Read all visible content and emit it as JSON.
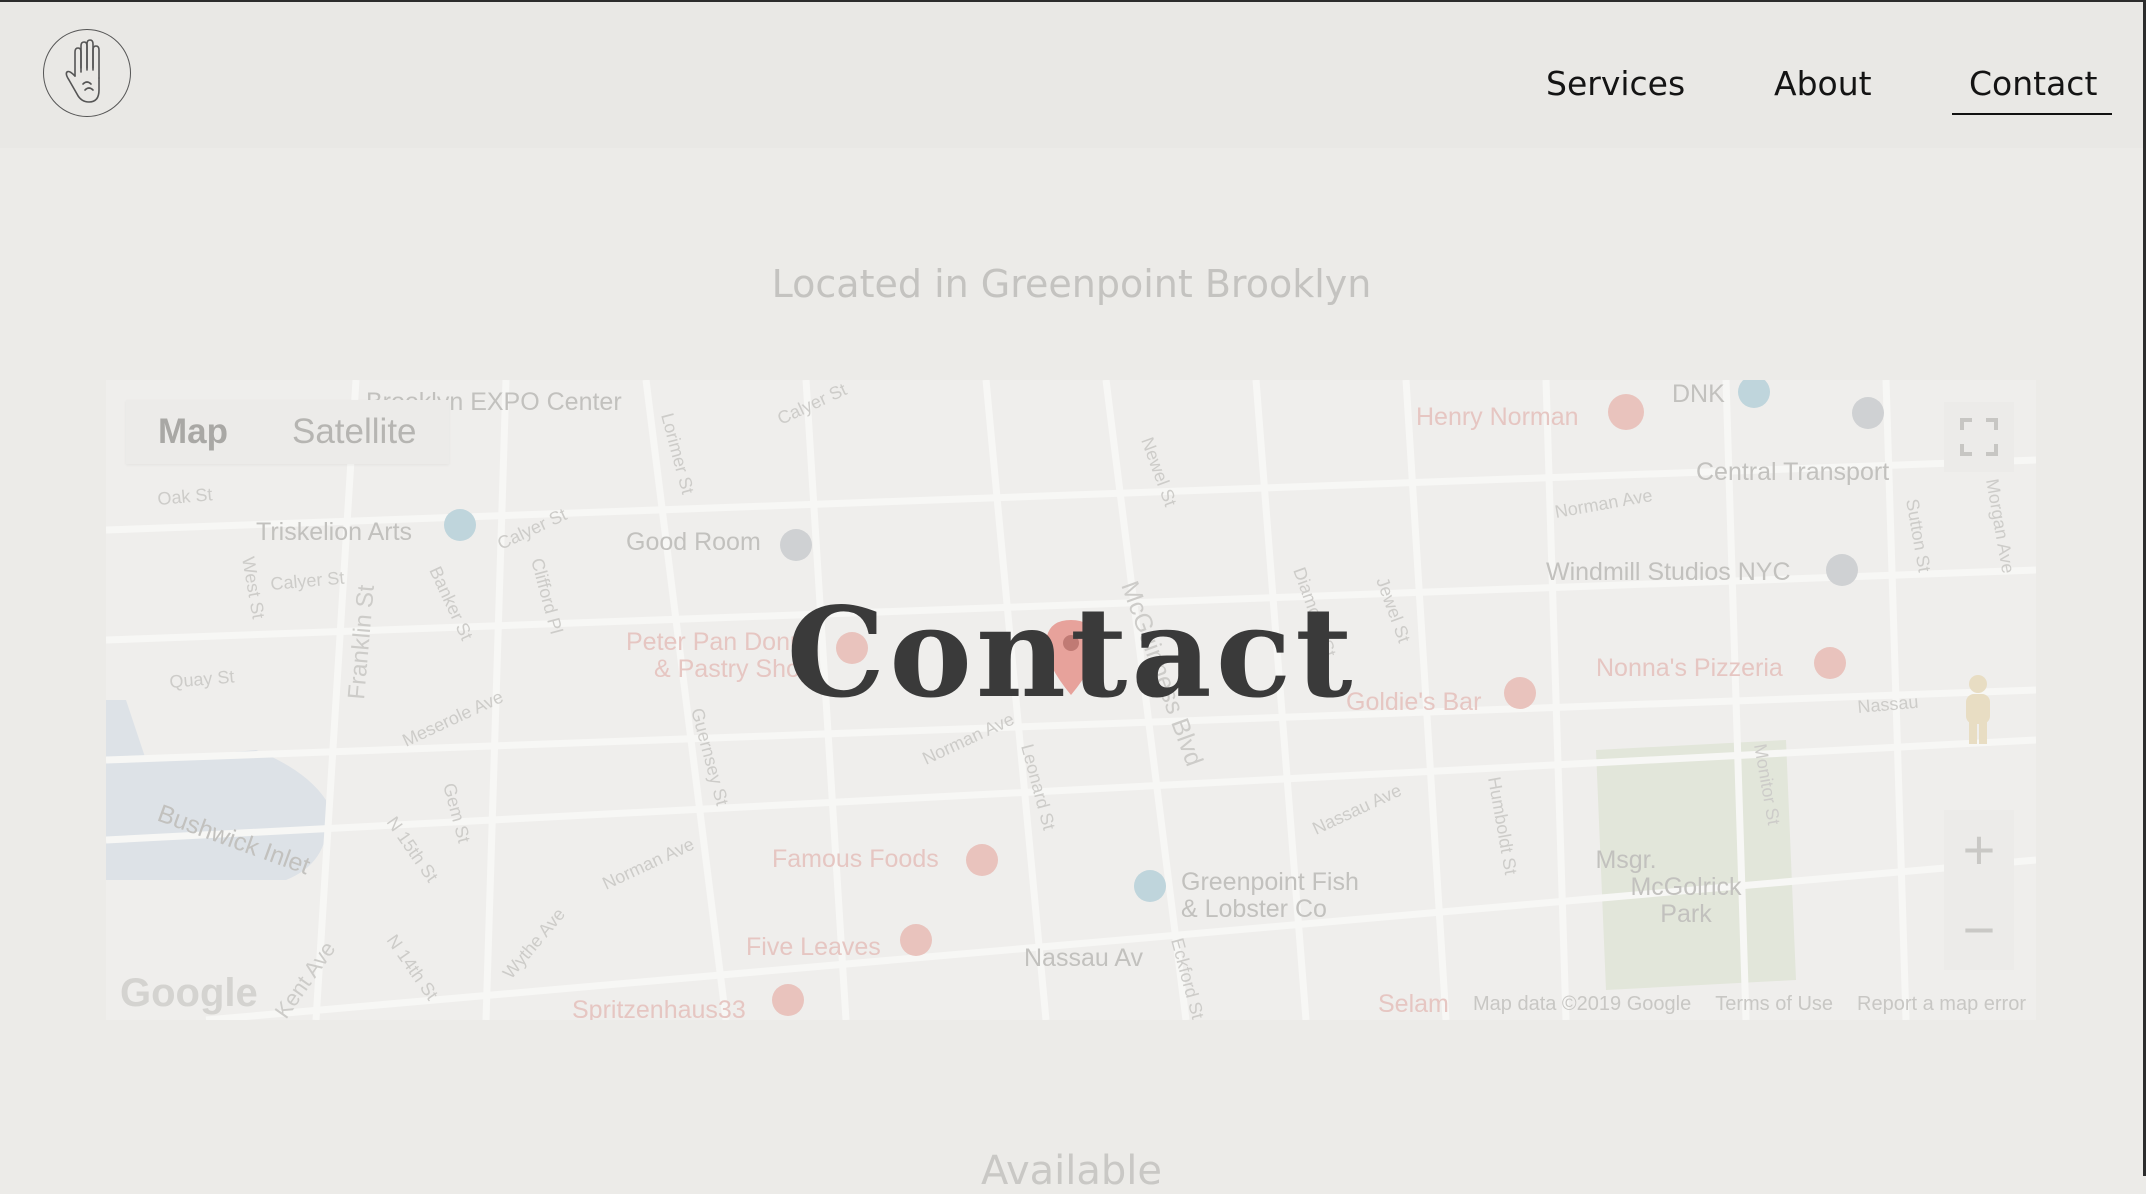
{
  "nav": {
    "services": "Services",
    "about": "About",
    "contact": "Contact"
  },
  "hero": {
    "subtitle": "Located in Greenpoint Brooklyn",
    "title": "Contact",
    "next_section": "Available"
  },
  "map": {
    "type_map": "Map",
    "type_satellite": "Satellite",
    "zoom_in": "+",
    "zoom_out": "−",
    "google_logo": "Google",
    "map_data": "Map data ©2019 Google",
    "terms": "Terms of Use",
    "report": "Report a map error",
    "poi_labels": {
      "expo": "Brooklyn EXPO Center",
      "triskelion": "Triskelion Arts",
      "good_room": "Good Room",
      "peter_pan_1": "Peter Pan Donut",
      "peter_pan_2": "& Pastry Shop",
      "famous_foods": "Famous Foods",
      "five_leaves": "Five Leaves",
      "spritzenhaus": "Spritzenhaus33",
      "henry_norman": "Henry Norman",
      "dnk": "DNK",
      "central_transport": "Central Transport",
      "windmill": "Windmill Studios NYC",
      "nonnas": "Nonna's Pizzeria",
      "goldies": "Goldie's Bar",
      "greenpoint_fish_1": "Greenpoint Fish",
      "greenpoint_fish_2": "& Lobster Co",
      "nassau_av": "Nassau Av",
      "park_1": "Msgr.",
      "park_2": "McGolrick",
      "park_3": "Park",
      "bushwick": "Bushwick Inlet",
      "selamat": "Selam"
    },
    "street_labels": {
      "oak": "Oak St",
      "calyer": "Calyer St",
      "calyer2": "Calyer St",
      "calyer3": "Calyer St",
      "quay": "Quay St",
      "west": "West St",
      "franklin": "Franklin St",
      "banker": "Banker St",
      "clifford": "Clifford Pl",
      "lorimer": "Lorimer St",
      "meserole": "Meserole Ave",
      "guernsey": "Guernsey St",
      "norman": "Norman Ave",
      "norman2": "Norman Ave",
      "norman3": "Norman Ave",
      "mcguinness": "McGuinness Blvd",
      "leonard": "Leonard St",
      "newel": "Newel St",
      "jewel": "Jewel St",
      "diamond": "Diamond St",
      "humboldt": "Humboldt St",
      "monitor": "Monitor St",
      "sutton": "Sutton St",
      "morgan": "Morgan Ave",
      "nassau_ave": "Nassau Ave",
      "nassau": "Nassau",
      "kent": "Kent Ave",
      "n15": "N 15th St",
      "n14": "N 14th St",
      "wythe": "Wythe Ave",
      "gem": "Gem St",
      "eckford": "Eckford St",
      "oak_ave": "Ave"
    }
  }
}
